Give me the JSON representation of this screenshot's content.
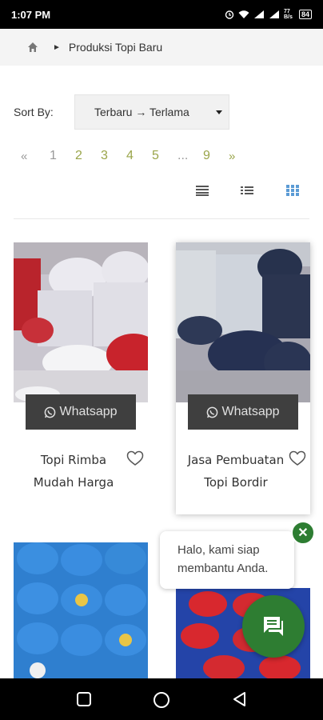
{
  "status_bar": {
    "time": "1:07 PM",
    "network_speed": "77 B/s",
    "battery": "84"
  },
  "breadcrumb": {
    "home_icon": "home-icon",
    "current": "Produksi Topi Baru"
  },
  "sort": {
    "label": "Sort By:",
    "selected": "Terbaru → Terlama"
  },
  "pagination": {
    "prev": "«",
    "pages": [
      "1",
      "2",
      "3",
      "4",
      "5"
    ],
    "ellipsis": "...",
    "last": "9",
    "next": "»",
    "current_page": "1"
  },
  "view_modes": [
    "list-compact-icon",
    "list-icon",
    "grid-icon"
  ],
  "colors": {
    "accent": "#9aa54a",
    "whatsapp_button": "#3f3f3f",
    "chat_green": "#2e7d32",
    "grid_active": "#5b9bd5"
  },
  "products": [
    {
      "title_line1": "Topi Rimba",
      "title_line2": "Mudah Harga",
      "button": "Whatsapp"
    },
    {
      "title_line1": "Jasa Pembuatan",
      "title_line2": "Topi Bordir",
      "button": "Whatsapp"
    }
  ],
  "chat": {
    "line1": "Halo, kami siap",
    "line2": "membantu Anda."
  }
}
